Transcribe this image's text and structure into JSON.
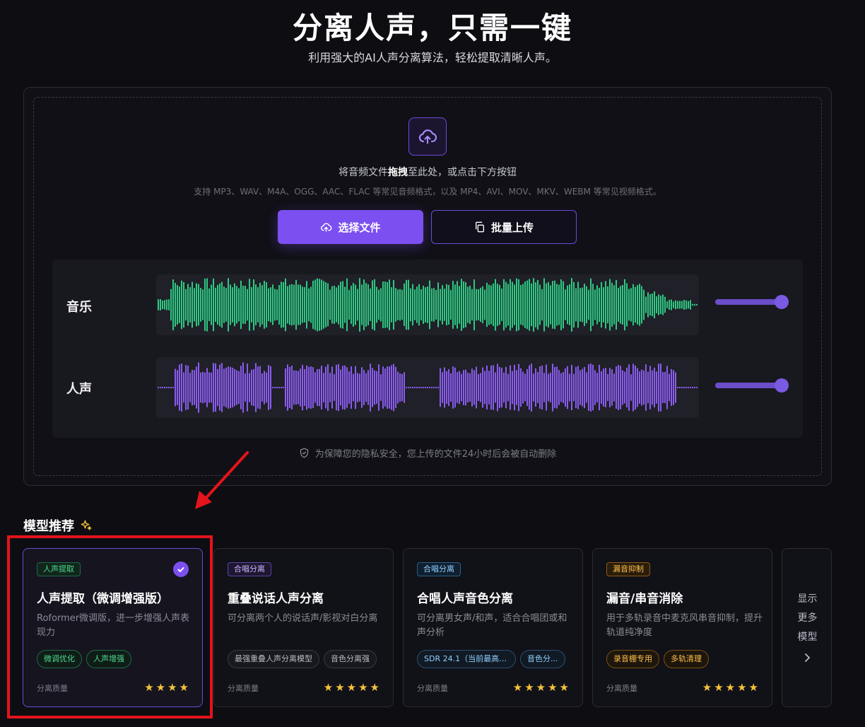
{
  "hero": {
    "title": "分离人声，只需一键",
    "subtitle": "利用强大的AI人声分离算法，轻松提取清晰人声。"
  },
  "upload": {
    "hint_prefix": "将音频文件",
    "hint_bold": "拖拽",
    "hint_suffix": "至此处，或点击下方按钮",
    "formats": "支持 MP3、WAV、M4A、OGG、AAC、FLAC 等常见音频格式，以及 MP4、AVI、MOV、MKV、WEBM 等常见视频格式。",
    "select_file_label": "选择文件",
    "batch_upload_label": "批量上传",
    "privacy_note": "为保障您的隐私安全，您上传的文件24小时后会被自动删除"
  },
  "tracks": [
    {
      "label": "音乐",
      "color": "#2fc882",
      "volume": 1.0
    },
    {
      "label": "人声",
      "color": "#8a5cf0",
      "volume": 1.0
    }
  ],
  "models": {
    "section_title": "模型推荐",
    "quality_label": "分离质量",
    "cards": [
      {
        "badge": "人声提取",
        "badge_style": "green",
        "title": "人声提取（微调增强版）",
        "desc": "Roformer微调版，进一步增强人声表现力",
        "tags": [
          "微调优化",
          "人声增强"
        ],
        "tag_style": "green",
        "stars": 4,
        "selected": true
      },
      {
        "badge": "合唱分离",
        "badge_style": "purple",
        "title": "重叠说话人声分离",
        "desc": "可分离两个人的说话声/影视对白分离",
        "tags": [
          "最强重叠人声分离模型",
          "音色分离强"
        ],
        "tag_style": "gray",
        "stars": 5,
        "selected": false
      },
      {
        "badge": "合唱分离",
        "badge_style": "blue",
        "title": "合唱人声音色分离",
        "desc": "可分离男女声/和声，适合合唱团或和声分析",
        "tags": [
          "SDR 24.1（当前最高之...",
          "音色分..."
        ],
        "tag_style": "blue",
        "stars": 5,
        "selected": false
      },
      {
        "badge": "漏音抑制",
        "badge_style": "orange",
        "title": "漏音/串音消除",
        "desc": "用于多轨录音中麦克风串音抑制，提升轨道纯净度",
        "tags": [
          "录音棚专用",
          "多轨清理"
        ],
        "tag_style": "orange",
        "stars": 5,
        "selected": false
      }
    ],
    "more_label_lines": [
      "显示",
      "更多",
      "模型"
    ]
  }
}
